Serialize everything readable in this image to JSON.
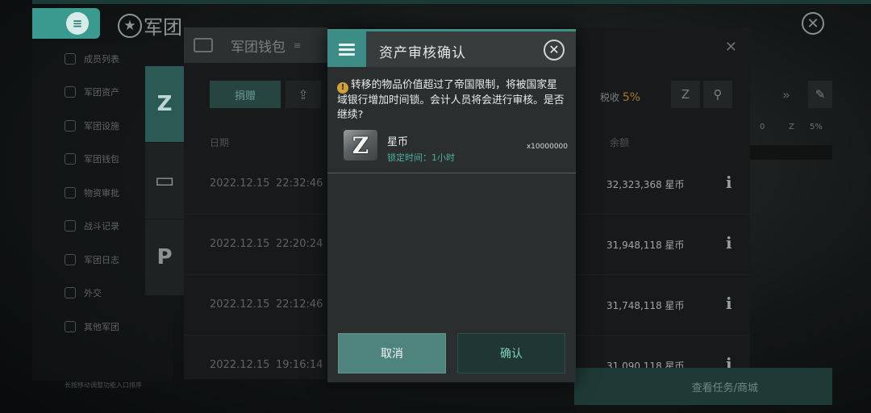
{
  "header": {
    "menu_icon": "list-icon",
    "title": "军团",
    "star": "★",
    "close": "✕"
  },
  "sidebar": {
    "items": [
      {
        "label": "成员列表"
      },
      {
        "label": "军团资产"
      },
      {
        "label": "军团设施"
      },
      {
        "label": "军团钱包"
      },
      {
        "label": "物资审批"
      },
      {
        "label": "战斗记录"
      },
      {
        "label": "军团日志"
      },
      {
        "label": "外交"
      },
      {
        "label": "其他军团"
      }
    ],
    "footer": "长按移动调整功能入口排序"
  },
  "wallet": {
    "title": "军团钱包",
    "sub_icon": "≡",
    "close": "✕",
    "tabs": [
      {
        "glyph": "Z"
      },
      {
        "glyph": "▭"
      },
      {
        "glyph": "P"
      }
    ],
    "donate_label": "捐赠",
    "export_glyph": "⇪",
    "tax_label": "税收",
    "tax_value": "5%",
    "summary": [
      "0",
      "Z",
      "5%"
    ],
    "columns": {
      "date": "日期",
      "balance": "余额"
    },
    "rows": [
      {
        "date": "2022.12.15",
        "time": "22:32:46",
        "balance": "32,323,368 星币"
      },
      {
        "date": "2022.12.15",
        "time": "22:20:24",
        "balance": "31,948,118 星币"
      },
      {
        "date": "2022.12.15",
        "time": "22:12:46",
        "balance": "31,748,118 星币"
      },
      {
        "date": "2022.12.15",
        "time": "19:16:14",
        "balance": "31,090,118 星币"
      }
    ],
    "info_glyph": "i",
    "bottom_button": "查看任务/商城"
  },
  "modal": {
    "title": "资产审核确认",
    "close": "✕",
    "warning_icon": "!",
    "warning_text": "转移的物品价值超过了帝国限制，将被国家星域银行增加时间锁。会计人员将会进行审核。是否继续?",
    "item": {
      "icon_glyph": "Z",
      "name": "星币",
      "lock_time": "锁定时间：1小时",
      "quantity": "x10000000"
    },
    "cancel_label": "取消",
    "confirm_label": "确认"
  },
  "colors": {
    "accent": "#3c8d85",
    "warning": "#d0a039",
    "lock_text": "#4fb0a3"
  }
}
